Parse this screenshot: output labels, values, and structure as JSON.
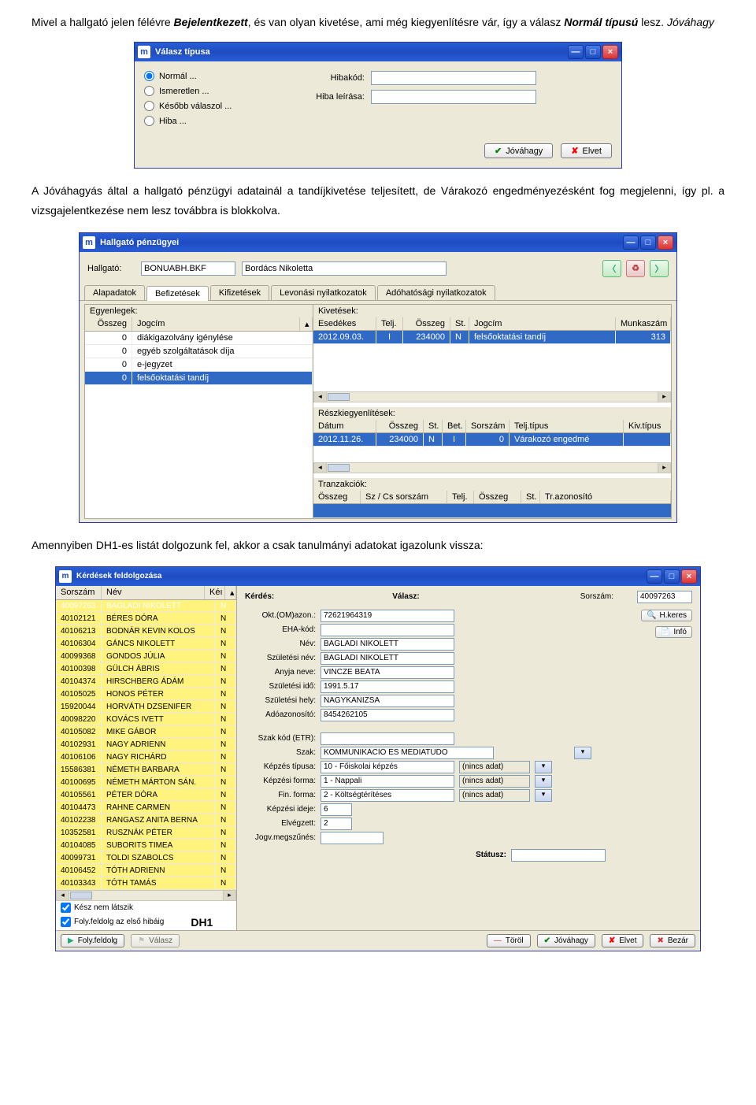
{
  "intro_text": "Mivel a hallgató jelen félévre Bejelentkezett, és van olyan kivetése, ami még kiegyenlítésre vár, így a válasz Normál típusú lesz. Jóváhagy",
  "win1": {
    "title": "Válasz típusa",
    "radio": {
      "normal": "Normál ...",
      "ismeretlen": "Ismeretlen ...",
      "kesobb": "Később válaszol ...",
      "hiba": "Hiba ..."
    },
    "hibakod_lbl": "Hibakód:",
    "hibaleiras_lbl": "Hiba leírása:",
    "jovahagy": "Jóváhagy",
    "elvet": "Elvet"
  },
  "para2": "A Jóváhagyás által a hallgató pénzügyi adatainál a tandíjkivetése teljesített, de Várakozó engedményezésként fog megjelenni, így pl. a vizsgajelentkezése nem lesz továbbra is blokkolva.",
  "win2": {
    "title": "Hallgató pénzügyei",
    "hallgato_lbl": "Hallgató:",
    "code": "BONUABH.BKF",
    "name": "Bordács Nikoletta",
    "tabs": [
      "Alapadatok",
      "Befizetések",
      "Kifizetések",
      "Levonási nyilatkozatok",
      "Adóhatósági nyilatkozatok"
    ],
    "egyenlegek": "Egyenlegek:",
    "kivetesek": "Kivetések:",
    "reszkieg": "Részkiegyenlítések:",
    "tranzakciok": "Tranzakciók:",
    "eg_head": [
      "Összeg",
      "Jogcím"
    ],
    "eg_rows": [
      [
        "0",
        "diákigazolvány igénylése"
      ],
      [
        "0",
        "egyéb szolgáltatások díja"
      ],
      [
        "0",
        "e-jegyzet"
      ],
      [
        "0",
        "felsőoktatási tandíj"
      ]
    ],
    "kv_head": [
      "Esedékes",
      "Telj.",
      "Összeg",
      "St.",
      "Jogcím",
      "Munkaszám"
    ],
    "kv_row": [
      "2012.09.03.",
      "I",
      "234000",
      "N",
      "felsőoktatási tandíj",
      "313"
    ],
    "rk_head": [
      "Dátum",
      "Összeg",
      "St.",
      "Bet.",
      "Sorszám",
      "Telj.típus",
      "Kiv.típus"
    ],
    "rk_row": [
      "2012.11.26.",
      "234000",
      "N",
      "I",
      "0",
      "Várakozó engedmé",
      ""
    ],
    "tr_head": [
      "Összeg",
      "Sz / Cs sorszám",
      "Telj.",
      "Összeg",
      "St.",
      "Tr.azonosító"
    ]
  },
  "para3": "Amennyiben DH1-es listát dolgozunk fel, akkor a csak tanulmányi adatokat igazolunk vissza:",
  "win3": {
    "title": "Kérdések feldolgozása",
    "list_head": [
      "Sorszám",
      "Név",
      "Kéı"
    ],
    "rows": [
      [
        "40097263",
        "BAGLADI NIKOLETT",
        "N"
      ],
      [
        "40102121",
        "BÉRES DÓRA",
        "N"
      ],
      [
        "40106213",
        "BODNÁR KEVIN KOLOS",
        "N"
      ],
      [
        "40106304",
        "GÁNCS NIKOLETT",
        "N"
      ],
      [
        "40099368",
        "GONDOS JÚLIA",
        "N"
      ],
      [
        "40100398",
        "GÜLCH ÁBRIS",
        "N"
      ],
      [
        "40104374",
        "HIRSCHBERG ÁDÁM",
        "N"
      ],
      [
        "40105025",
        "HONOS PÉTER",
        "N"
      ],
      [
        "15920044",
        "HORVÁTH DZSENIFER",
        "N"
      ],
      [
        "40098220",
        "KOVÁCS IVETT",
        "N"
      ],
      [
        "40105082",
        "MIKE GÁBOR",
        "N"
      ],
      [
        "40102931",
        "NAGY ADRIENN",
        "N"
      ],
      [
        "40106106",
        "NAGY RICHÁRD",
        "N"
      ],
      [
        "15586381",
        "NÉMETH BARBARA",
        "N"
      ],
      [
        "40100695",
        "NÉMETH MÁRTON SÁN.",
        "N"
      ],
      [
        "40105561",
        "PÉTER DÓRA",
        "N"
      ],
      [
        "40104473",
        "RAHNE CARMEN",
        "N"
      ],
      [
        "40102238",
        "RANGASZ ANITA BERNA",
        "N"
      ],
      [
        "10352581",
        "RUSZNÁK PÉTER",
        "N"
      ],
      [
        "40104085",
        "SUBORITS TIMEA",
        "N"
      ],
      [
        "40099731",
        "TOLDI SZABOLCS",
        "N"
      ],
      [
        "40106452",
        "TÓTH ADRIENN",
        "N"
      ],
      [
        "40103343",
        "TÓTH TAMÁS",
        "N"
      ]
    ],
    "kerdes_lbl": "Kérdés:",
    "valasz_lbl": "Válasz:",
    "sorszam_lbl": "Sorszám:",
    "sorszam_v": "40097263",
    "hkeres": "H.keres",
    "info": "Infó",
    "fields": {
      "okt_l": "Okt.(OM)azon.:",
      "okt_v": "72621964319",
      "eha_l": "EHA-kód:",
      "eha_v": "",
      "nev_l": "Név:",
      "nev_v": "BAGLADI NIKOLETT",
      "szn_l": "Születési név:",
      "szn_v": "BAGLADI NIKOLETT",
      "any_l": "Anyja neve:",
      "any_v": "VINCZE BEÁTA",
      "szi_l": "Születési idő:",
      "szi_v": "1991.5.17",
      "szh_l": "Születési hely:",
      "szh_v": "NAGYKANIZSA",
      "ado_l": "Adóazonosító:",
      "ado_v": "8454262105",
      "szk_l": "Szak kód (ETR):",
      "szk_v": "",
      "szak_l": "Szak:",
      "szak_v": "KOMMUNIKÁCIÓ ÉS MÉDIATUDO",
      "kt_l": "Képzés típusa:",
      "kt_v": "10 - Főiskolai képzés",
      "kt_r": "(nincs adat)",
      "kf_l": "Képzési forma:",
      "kf_v": "1 - Nappali",
      "kf_r": "(nincs adat)",
      "ff_l": "Fin. forma:",
      "ff_v": "2 - Költségtérítéses",
      "ff_r": "(nincs adat)",
      "ki_l": "Képzési ideje:",
      "ki_v": "6",
      "ev_l": "Elvégzett:",
      "ev_v": "2",
      "jm_l": "Jogv.megszűnés:",
      "jm_v": "",
      "stat_l": "Státusz:"
    },
    "chk1": "Kész nem látszik",
    "chk2": "Foly.feldolg az első hibáig",
    "dh1": "DH1",
    "foot": {
      "foly": "Foly.feldolg",
      "valasz": "Válasz",
      "torol": "Töröl",
      "jovahagy": "Jóváhagy",
      "elvet": "Elvet",
      "bezar": "Bezár"
    }
  }
}
